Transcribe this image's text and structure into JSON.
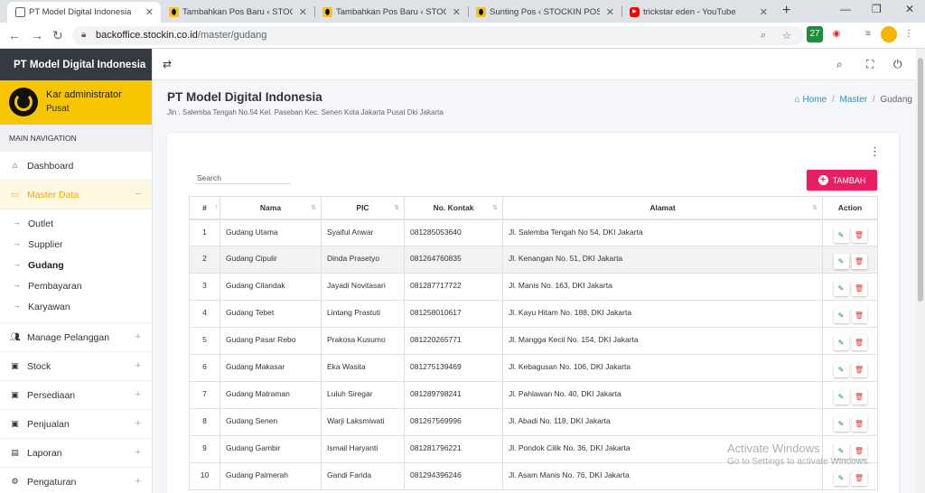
{
  "browser": {
    "tabs": [
      {
        "title": "PT Model Digital Indonesia",
        "icon": "document-icon",
        "active": true
      },
      {
        "title": "Tambahkan Pos Baru ‹ STOCKIN",
        "icon": "stockin-icon",
        "active": false
      },
      {
        "title": "Tambahkan Pos Baru ‹ STOCKIN",
        "icon": "stockin-icon",
        "active": false
      },
      {
        "title": "Sunting Pos ‹ STOCKIN POS —",
        "icon": "stockin-icon",
        "active": false
      },
      {
        "title": "trickstar eden - YouTube",
        "icon": "youtube-icon",
        "active": false
      }
    ],
    "url_host": "backoffice.stockin.co.id",
    "url_path": "/master/gudang",
    "ext_badge": "27"
  },
  "sidebar": {
    "brand": "PT Model Digital Indonesia",
    "user_name": "Kar administrator",
    "user_role": "Pusat",
    "nav_header": "MAIN NAVIGATION",
    "dashboard": "Dashboard",
    "master_data": "Master Data",
    "master_sub": [
      "Outlet",
      "Supplier",
      "Gudang",
      "Pembayaran",
      "Karyawan"
    ],
    "manage_pelanggan": "Manage Pelanggan",
    "stock": "Stock",
    "persediaan": "Persediaan",
    "penjualan": "Penjualan",
    "laporan": "Laporan",
    "pengaturan": "Pengaturan",
    "collapse_minus": "−",
    "expand_plus": "+"
  },
  "header": {
    "company_name": "PT Model Digital Indonesia",
    "company_address": "Jln . Salemba Tengah No.54 Kel. Paseban Kec. Senen Kota Jakarta Pusat Dki Jakarta",
    "breadcrumb": {
      "home": "Home",
      "master": "Master",
      "current": "Gudang",
      "sep": "/"
    }
  },
  "card": {
    "search_label": "Search",
    "add_button": "TAMBAH"
  },
  "table": {
    "columns": [
      "#",
      "Nama",
      "PIC",
      "No. Kontak",
      "Alamat",
      "Action"
    ],
    "rows": [
      {
        "no": "1",
        "nama": "Gudang Utama",
        "pic": "Syaiful Anwar",
        "kontak": "081285053640",
        "alamat": "Jl. Salemba Tengah No 54, DKI Jakarta"
      },
      {
        "no": "2",
        "nama": "Gudang Cipulir",
        "pic": "Dinda Prasetyo",
        "kontak": "081264760835",
        "alamat": "Jl. Kenangan No. 51, DKI Jakarta"
      },
      {
        "no": "3",
        "nama": "Gudang Cilandak",
        "pic": "Jayadi Novitasari",
        "kontak": "081287717722",
        "alamat": "Jl. Manis No. 163, DKI Jakarta"
      },
      {
        "no": "4",
        "nama": "Gudang Tebet",
        "pic": "Lintang Prastuti",
        "kontak": "081258010617",
        "alamat": "Jl. Kayu Hitam No. 188, DKI Jakarta"
      },
      {
        "no": "5",
        "nama": "Gudang Pasar Rebo",
        "pic": "Prakosa Kusumo",
        "kontak": "081220265771",
        "alamat": "Jl. Mangga Kecil No. 154, DKI Jakarta"
      },
      {
        "no": "6",
        "nama": "Gudang Makasar",
        "pic": "Eka Wasita",
        "kontak": "081275139469",
        "alamat": "Jl. Kebagusan No. 106, DKI Jakarta"
      },
      {
        "no": "7",
        "nama": "Gudang Matraman",
        "pic": "Luluh Siregar",
        "kontak": "081289798241",
        "alamat": "Jl. Pahlawan No. 40, DKI Jakarta"
      },
      {
        "no": "8",
        "nama": "Gudang Senen",
        "pic": "Warji Laksmiwati",
        "kontak": "081267569996",
        "alamat": "Jl. Abadi No. 118, DKI Jakarta"
      },
      {
        "no": "9",
        "nama": "Gudang Gambir",
        "pic": "Ismail Haryanti",
        "kontak": "081281796221",
        "alamat": "Jl. Pondok Cilik No. 36, DKI Jakarta"
      },
      {
        "no": "10",
        "nama": "Gudang Palmerah",
        "pic": "Gandi Farida",
        "kontak": "081294396246",
        "alamat": "Jl. Asam Manis No. 76, DKI Jakarta"
      }
    ]
  },
  "watermark": {
    "line1": "Activate Windows",
    "line2": "Go to Settings to activate Windows."
  },
  "colors": {
    "accent_yellow": "#f7c600",
    "add_button": "#e91e63",
    "brand_bg": "#343a40",
    "link": "#3c8dbc",
    "edit_icon": "#1b8a3a",
    "delete_icon": "#e53935"
  }
}
